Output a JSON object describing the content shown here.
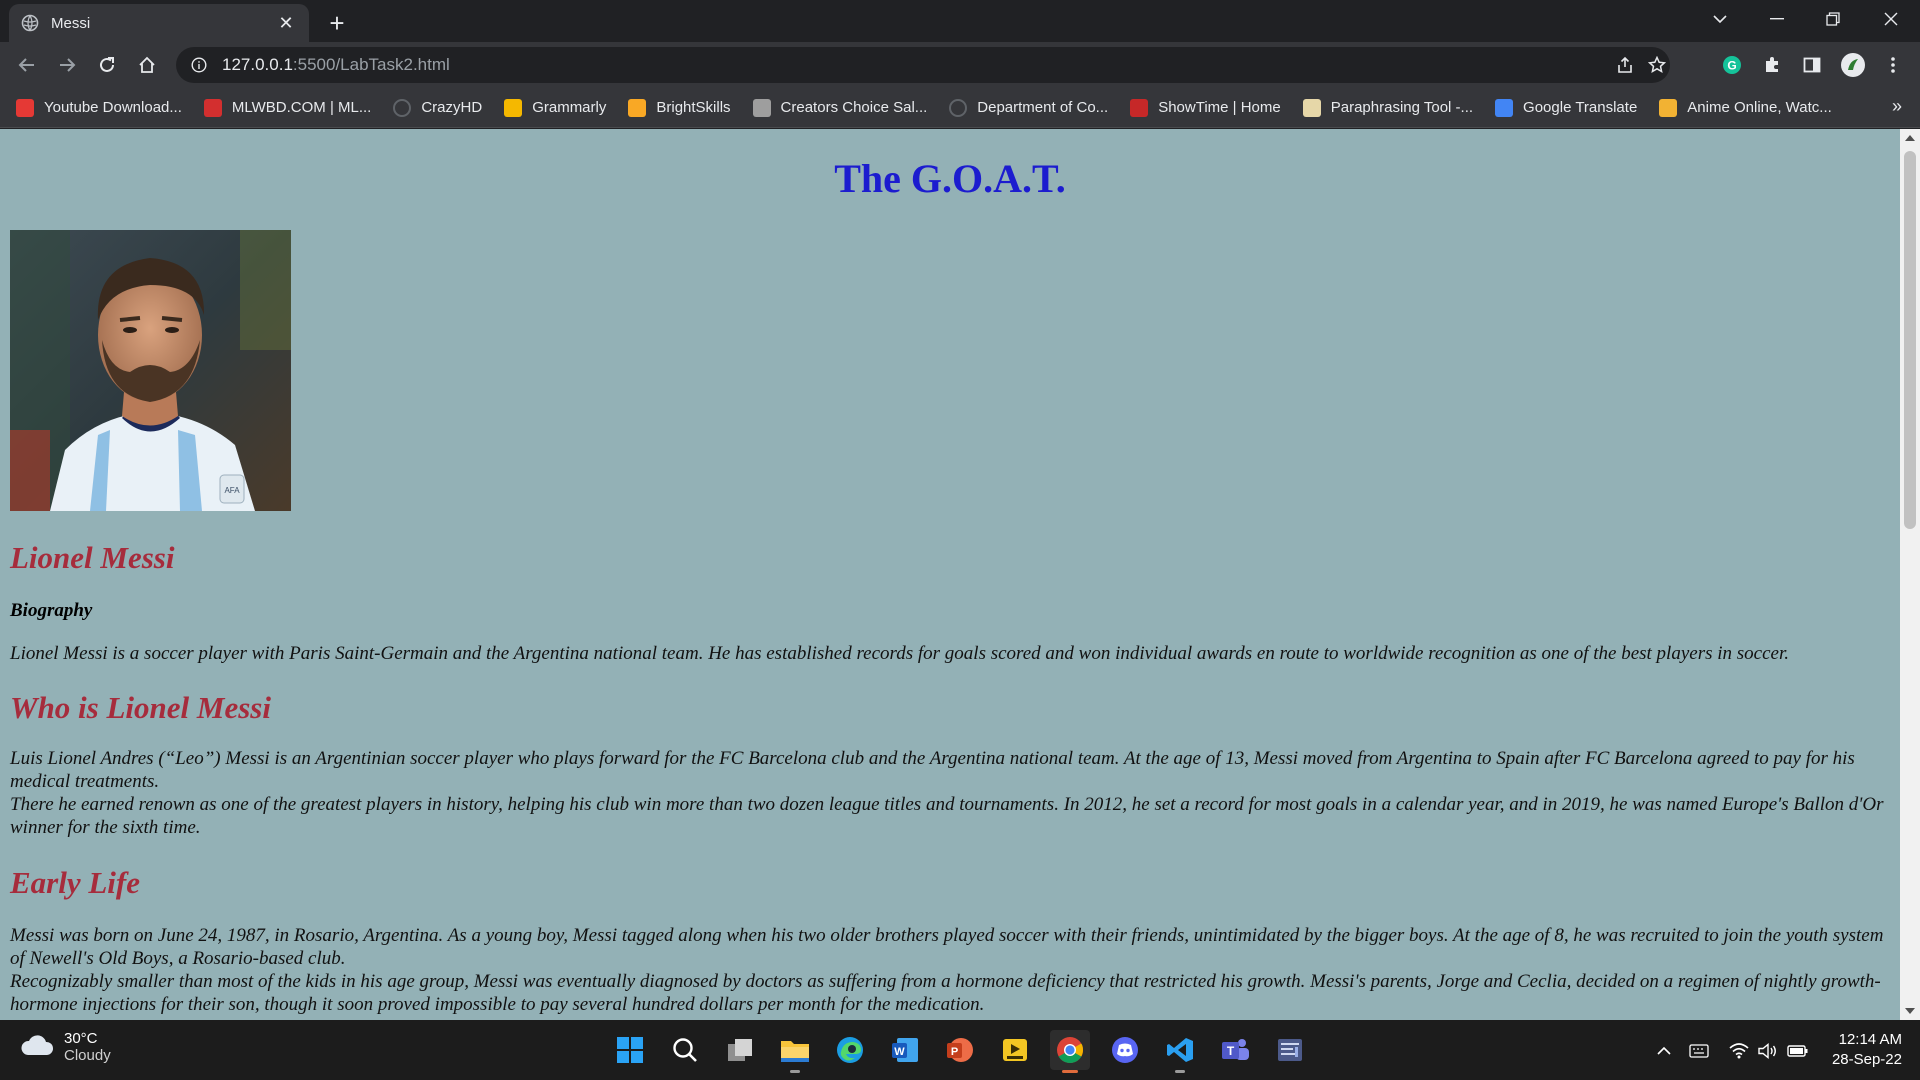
{
  "browser": {
    "tab_title": "Messi",
    "url_host": "127.0.0.1",
    "url_path": ":5500/LabTask2.html"
  },
  "bookmarks": [
    {
      "label": "Youtube Download...",
      "icon": "youtube-downloader-icon",
      "color": "#e53935"
    },
    {
      "label": "MLWBD.COM | ML...",
      "icon": "mlwbd-icon",
      "color": "#d32f2f"
    },
    {
      "label": "CrazyHD",
      "icon": "globe-icon",
      "color": "#5f6368"
    },
    {
      "label": "Grammarly",
      "icon": "grammarly-icon",
      "color": "#f5b800"
    },
    {
      "label": "BrightSkills",
      "icon": "brightskills-icon",
      "color": "#f9a825"
    },
    {
      "label": "Creators Choice Sal...",
      "icon": "creators-choice-icon",
      "color": "#9e9e9e"
    },
    {
      "label": "Department of Co...",
      "icon": "globe-icon",
      "color": "#5f6368"
    },
    {
      "label": "ShowTime | Home",
      "icon": "showtime-icon",
      "color": "#c62828"
    },
    {
      "label": "Paraphrasing Tool -...",
      "icon": "paraphrasing-tool-icon",
      "color": "#e6d7a8"
    },
    {
      "label": "Google Translate",
      "icon": "google-translate-icon",
      "color": "#4285f4"
    },
    {
      "label": "Anime Online, Watc...",
      "icon": "anime-icon",
      "color": "#f2b233"
    }
  ],
  "page": {
    "title": "The G.O.A.T.",
    "name_heading": "Lionel Messi",
    "bio_label": "Biography",
    "bio_text": "Lionel Messi is a soccer player with Paris Saint-Germain and the Argentina national team. He has established records for goals scored and won individual awards en route to worldwide recognition as one of the best players in soccer.",
    "who_heading": "Who is Lionel Messi",
    "who_p1": "Luis Lionel Andres (“Leo”) Messi is an Argentinian soccer player who plays forward for the FC Barcelona club and the Argentina national team. At the age of 13, Messi moved from Argentina to Spain after FC Barcelona agreed to pay for his medical treatments.",
    "who_p2": "There he earned renown as one of the greatest players in history, helping his club win more than two dozen league titles and tournaments. In 2012, he set a record for most goals in a calendar year, and in 2019, he was named Europe's Ballon d'Or winner for the sixth time.",
    "early_heading": "Early Life",
    "early_p1": "Messi was born on June 24, 1987, in Rosario, Argentina. As a young boy, Messi tagged along when his two older brothers played soccer with their friends, unintimidated by the bigger boys. At the age of 8, he was recruited to join the youth system of Newell's Old Boys, a Rosario-based club.",
    "early_p2": "Recognizably smaller than most of the kids in his age group, Messi was eventually diagnosed by doctors as suffering from a hormone deficiency that restricted his growth. Messi's parents, Jorge and Ceclia, decided on a regimen of nightly growth-hormone injections for their son, though it soon proved impossible to pay several hundred dollars per month for the medication."
  },
  "taskbar": {
    "temperature": "30°C",
    "condition": "Cloudy",
    "time": "12:14 AM",
    "date": "28-Sep-22"
  }
}
